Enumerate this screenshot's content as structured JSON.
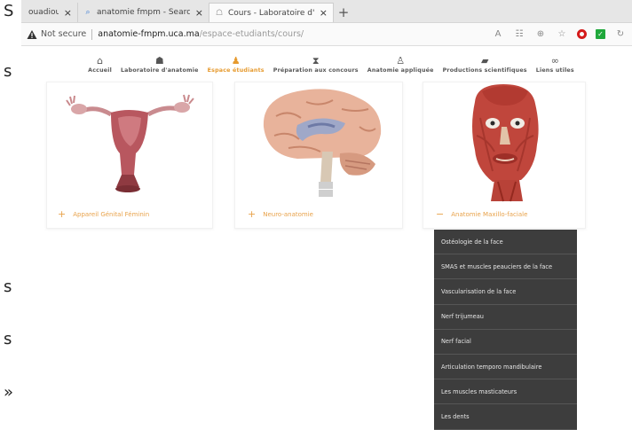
{
  "left_strip": {
    "chars": [
      "S",
      "s",
      "s",
      "s",
      "»"
    ]
  },
  "tabs": [
    {
      "label": "ouadiouby@ç",
      "icon": "mail-icon"
    },
    {
      "label": "anatomie fmpm - Search",
      "icon": "search-icon"
    },
    {
      "label": "Cours - Laboratoire d'anatomie",
      "icon": "page-icon"
    }
  ],
  "newtab_label": "+",
  "tab_close": "×",
  "address": {
    "security_text": "Not secure",
    "host": "anatomie-fmpm.uca.ma",
    "path": "/espace-etudiants/cours/"
  },
  "nav": {
    "items": [
      {
        "label": "Accueil",
        "icon": "home-icon",
        "glyph": "⌂",
        "active": false
      },
      {
        "label": "Laboratoire d'anatomie",
        "icon": "users-icon",
        "glyph": "☗",
        "active": false
      },
      {
        "label": "Espace étudiants",
        "icon": "student-icon",
        "glyph": "♟",
        "active": true
      },
      {
        "label": "Préparation aux concours",
        "icon": "hourglass-icon",
        "glyph": "⧗",
        "active": false
      },
      {
        "label": "Anatomie appliquée",
        "icon": "doctor-icon",
        "glyph": "♙",
        "active": false
      },
      {
        "label": "Productions scientifiques",
        "icon": "graduation-cap-icon",
        "glyph": "▰",
        "active": false
      },
      {
        "label": "Liens utiles",
        "icon": "link-icon",
        "glyph": "∞",
        "active": false
      }
    ]
  },
  "cards": [
    {
      "title": "Appareil Génital Féminin",
      "sign": "+",
      "image": "uterus-illustration"
    },
    {
      "title": "Neuro-anatomie",
      "sign": "+",
      "image": "brain-illustration"
    },
    {
      "title": "Anatomie Maxillo-faciale",
      "sign": "−",
      "image": "face-muscles-illustration"
    }
  ],
  "submenu": {
    "items": [
      "Ostéologie de la face",
      "SMAS et muscles peauciers de la face",
      "Vascularisation de la face",
      "Nerf trijumeau",
      "Nerf facial",
      "Articulation temporo mandibulaire",
      "Les muscles masticateurs",
      "Les dents"
    ]
  },
  "colors": {
    "accent": "#e8a24a",
    "submenu_bg": "#3d3d3d"
  }
}
